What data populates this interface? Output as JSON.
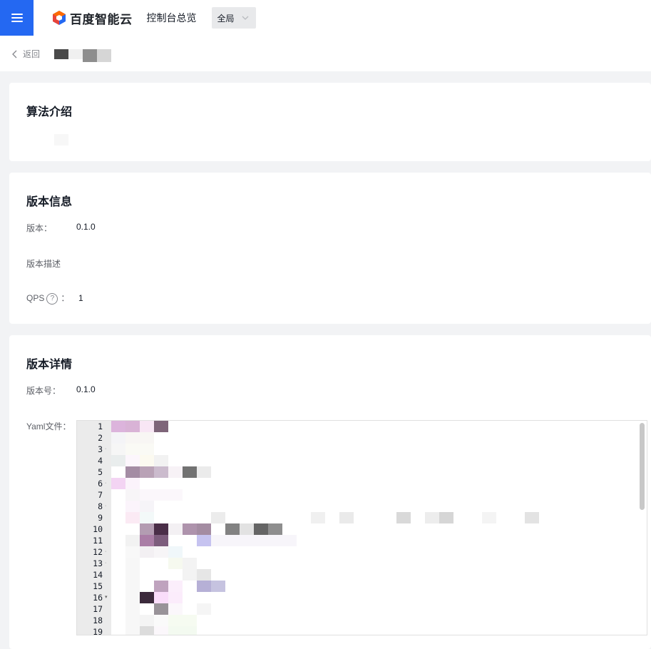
{
  "header": {
    "brand": "百度智能云",
    "console_link": "控制台总览",
    "region_selected": "全局",
    "menu_icon": "hamburger-icon",
    "brand_color": "#2468f2"
  },
  "breadcrumb": {
    "back_label": "返回",
    "back_icon": "chevron-left-icon"
  },
  "intro_card": {
    "title": "算法介绍"
  },
  "version_info": {
    "title": "版本信息",
    "version_label": "版本：",
    "version_value": "0.1.0",
    "desc_label": "版本描述",
    "qps_label": "QPS",
    "qps_help_icon": "question-circle-icon",
    "qps_help": "?",
    "qps_colon": "：",
    "qps_value": "1"
  },
  "version_detail": {
    "title": "版本详情",
    "version_no_label": "版本号：",
    "version_no_value": "0.1.0",
    "yaml_label": "Yaml文件：",
    "line_numbers": [
      "1",
      "2",
      "3",
      "4",
      "5",
      "6",
      "7",
      "8",
      "9",
      "10",
      "11",
      "12",
      "13",
      "14",
      "15",
      "16",
      "17",
      "18",
      "19"
    ],
    "folded_lines": [
      "3",
      "6",
      "8",
      "12",
      "13",
      "16"
    ]
  }
}
